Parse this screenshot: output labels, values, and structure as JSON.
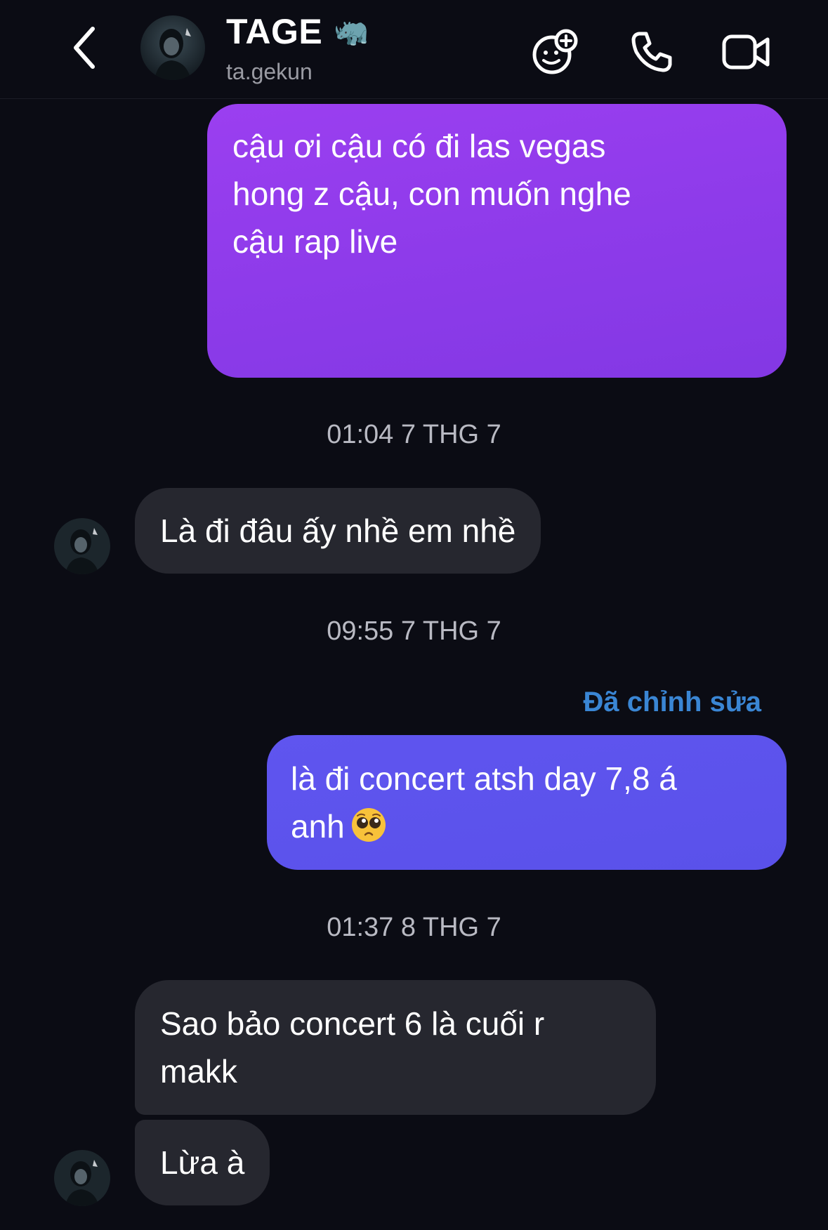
{
  "header": {
    "contact_name": "TAGE",
    "name_emoji": "🦏",
    "username": "ta.gekun",
    "icons": {
      "back": "chevron-left-icon",
      "effects": "sticker-add-icon",
      "call": "phone-icon",
      "video": "video-camera-icon"
    }
  },
  "messages": [
    {
      "type": "outgoing",
      "text": "cậu ơi cậu có đi las vegas\nhong z cậu, con muốn nghe\ncậu rap live"
    },
    {
      "type": "timestamp",
      "text": "01:04 7 THG 7"
    },
    {
      "type": "incoming",
      "text": "Là đi đâu ấy nhề em nhề"
    },
    {
      "type": "timestamp",
      "text": "09:55 7 THG 7"
    },
    {
      "type": "edited",
      "text": "Đã chỉnh sửa"
    },
    {
      "type": "outgoing",
      "text": "là đi concert atsh day 7,8 á\nanh",
      "emoji": "pleading-face-emoji"
    },
    {
      "type": "timestamp",
      "text": "01:37 8 THG 7"
    },
    {
      "type": "incoming",
      "text": "Sao bảo concert 6 là cuối r\nmakk"
    },
    {
      "type": "incoming",
      "text": "Lừa à"
    }
  ],
  "colors": {
    "background": "#0b0c14",
    "outgoing_bubble_1": "#8e3bea",
    "outgoing_bubble_2": "#5a51ea",
    "incoming_bubble": "#26272f",
    "edited_label": "#3a86d4",
    "timestamp": "#b9bac3"
  }
}
